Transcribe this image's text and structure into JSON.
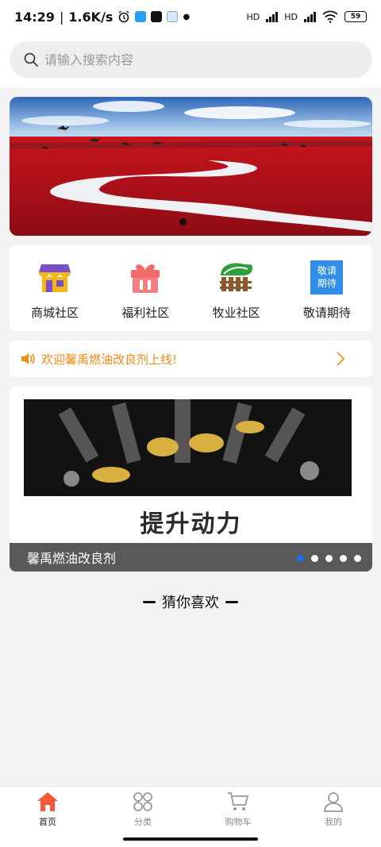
{
  "status_bar": {
    "time": "14:29",
    "speed": "1.6K/s",
    "hd1": "HD",
    "hd2": "HD",
    "battery": "59"
  },
  "search": {
    "placeholder": "请输入搜索内容",
    "icon": "search-icon"
  },
  "banner": {
    "slide_count": 1,
    "active_index": 0
  },
  "quick_menu": [
    {
      "label": "商城社区",
      "icon": "shop-icon",
      "color": "#f5b61a"
    },
    {
      "label": "福利社区",
      "icon": "gift-icon",
      "color": "#f06a6a"
    },
    {
      "label": "牧业社区",
      "icon": "ranch-fence-icon",
      "color": "#2e9e3f"
    },
    {
      "label": "敬请期待",
      "icon_text_1": "敬请",
      "icon_text_2": "期待",
      "color": "#2f8fe8"
    }
  ],
  "notice": {
    "text": "欢迎馨禹燃油改良剂上线!",
    "icon": "speaker-icon",
    "color": "#f28b15"
  },
  "ad": {
    "slogan": "提升动力",
    "caption": "馨禹燃油改良剂",
    "dot_count": 5,
    "active_dot": 0,
    "dot_active_color": "#1e6cf0"
  },
  "section": {
    "title": "猜你喜欢"
  },
  "tabs": [
    {
      "label": "首页",
      "icon": "home-icon",
      "active": true
    },
    {
      "label": "分类",
      "icon": "category-icon",
      "active": false
    },
    {
      "label": "购物车",
      "icon": "cart-icon",
      "active": false
    },
    {
      "label": "我的",
      "icon": "user-icon",
      "active": false
    }
  ],
  "accent": "#f25a3a"
}
